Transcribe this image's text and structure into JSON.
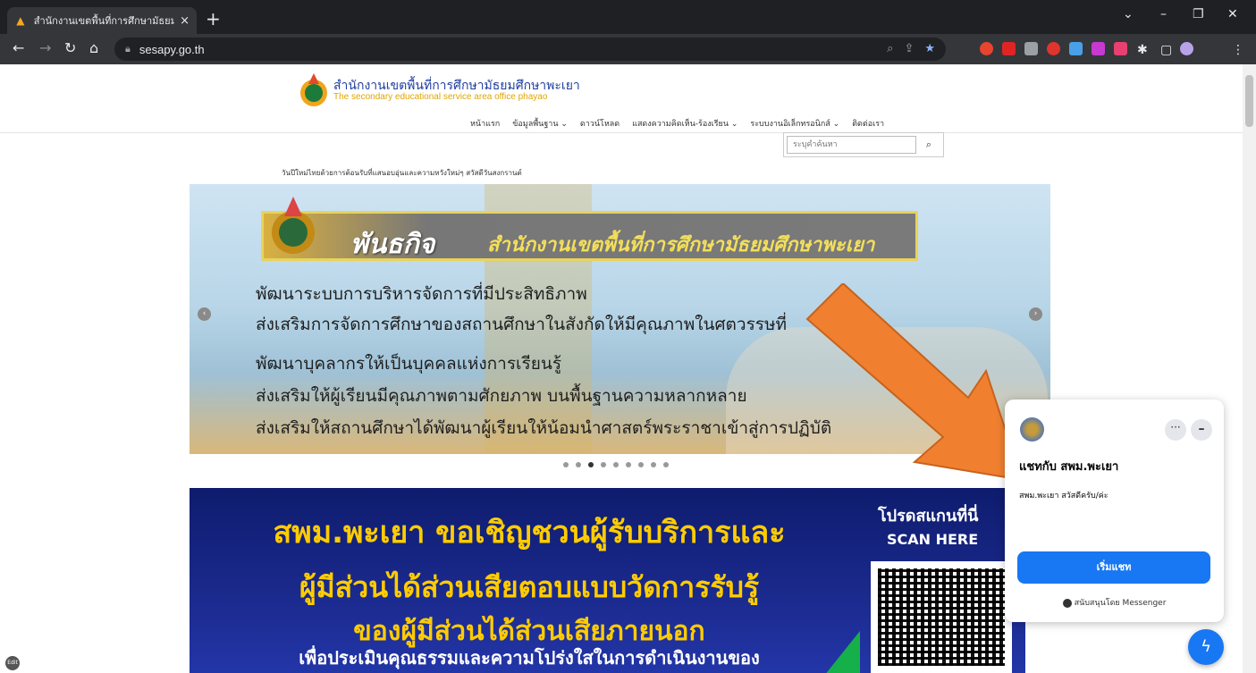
{
  "browser": {
    "tab_title": "สำนักงานเขตพื้นที่การศึกษามัธยมศึกษ...",
    "tab_close": "×",
    "new_tab": "+",
    "url": "sesapy.go.th",
    "window_controls": {
      "minimize": "–",
      "restore": "❐",
      "close": "✕",
      "dropdown": "⌄"
    }
  },
  "site": {
    "title": "สำนักงานเขตพื้นที่การศึกษามัธยมศึกษาพะเยา",
    "subtitle": "The secondary educational service area office phayao",
    "menu": [
      "หน้าแรก",
      "ข้อมูลพื้นฐาน ⌄",
      "ดาวน์โหลด",
      "แสดงความคิดเห็น-ร้องเรียน ⌄",
      "ระบบงานอิเล็กทรอนิกส์ ⌄",
      "ติดต่อเรา"
    ],
    "search_placeholder": "ระบุคำค้นหา",
    "search_icon": "⌕",
    "marquee": "วันปีใหม่ไทยด้วยการต้อนรับที่แสนอบอุ่นและความหวังใหม่ๆ สวัสดีวันสงกรานต์"
  },
  "slider": {
    "banner_title": "พันธกิจ",
    "banner_subtitle": "สำนักงานเขตพื้นที่การศึกษามัธยมศึกษาพะเยา",
    "mission": [
      "พัฒนาระบบการบริหารจัดการที่มีประสิทธิภาพ",
      "ส่งเสริมการจัดการศึกษาของสถานศึกษาในสังกัดให้มีคุณภาพในศตวรรษที่",
      "พัฒนาบุคลากรให้เป็นบุคคลแห่งการเรียนรู้",
      "ส่งเสริมให้ผู้เรียนมีคุณภาพตามศักยภาพ บนพื้นฐานความหลากหลาย",
      "ส่งเสริมให้สถานศึกษาได้พัฒนาผู้เรียนให้น้อมนำศาสตร์พระราชาเข้าสู่การปฏิบัติ"
    ],
    "prev": "‹",
    "next": "›",
    "dot_count": 9,
    "active_dot": 3
  },
  "poster": {
    "line1": "สพม.พะเยา ขอเชิญชวนผู้รับบริการและ",
    "line2": "ผู้มีส่วนได้ส่วนเสียตอบแบบวัดการรับรู้",
    "line3": "ของผู้มีส่วนได้ส่วนเสียภายนอก",
    "line4": "เพื่อประเมินคุณธรรมและความโปร่งใสในการดำเนินงานของ",
    "scan1": "โปรดสแกนที่นี่",
    "scan2": "SCAN HERE"
  },
  "chat": {
    "title": "แชทกับ สพม.พะเยา",
    "message": "สพม.พะเยา สวัสดีครับ/ค่ะ",
    "start_button": "เริ่มแชท",
    "powered": "สนับสนุนโดย Messenger",
    "more": "···",
    "minimize": "–"
  },
  "colors": {
    "accent_orange": "#f08030",
    "messenger_blue": "#1877f2",
    "site_title_blue": "#203f9e",
    "site_sub_gold": "#e0a500"
  }
}
